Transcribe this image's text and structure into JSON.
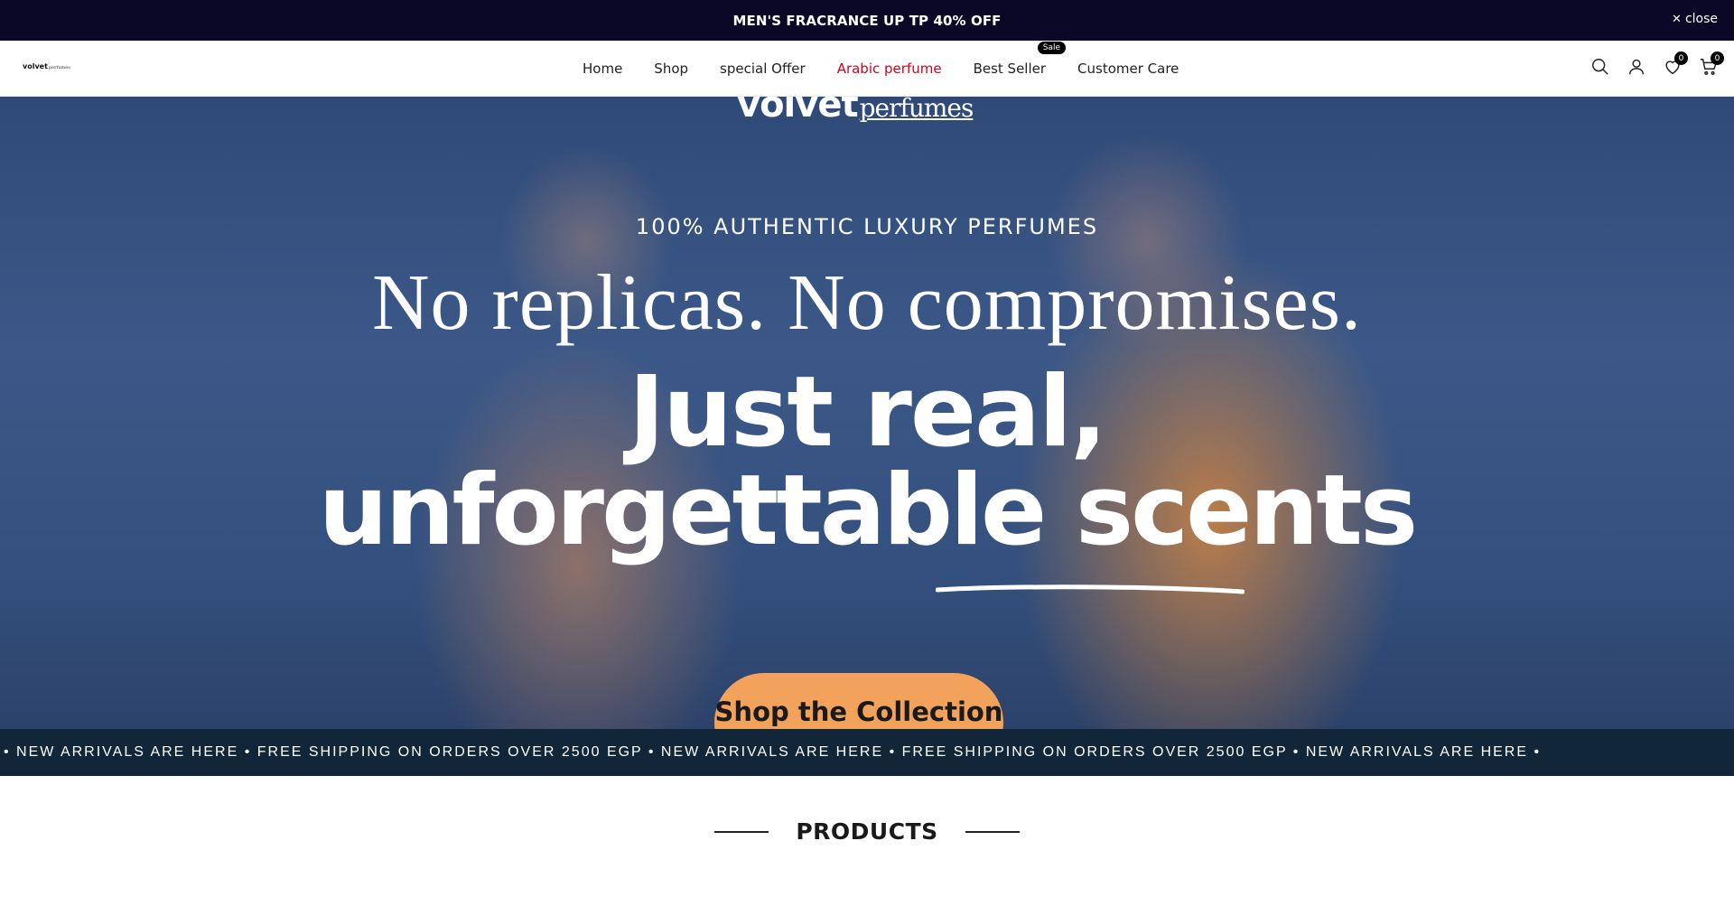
{
  "announcement": {
    "text": "MEN'S FRACRANCE UP TP 40% OFF",
    "close_label": "close",
    "close_icon": "close-icon"
  },
  "header": {
    "logo": {
      "main": "volvet",
      "sub": "perfumes"
    },
    "nav": [
      {
        "label": "Home"
      },
      {
        "label": "Shop"
      },
      {
        "label": "special Offer"
      },
      {
        "label": "Arabic perfume",
        "color": "#d0021b"
      },
      {
        "label": "Best Seller",
        "badge": "Sale"
      },
      {
        "label": "Customer Care"
      }
    ],
    "icons": {
      "search": "search-icon",
      "account": "user-icon",
      "wishlist": {
        "icon": "heart-icon",
        "count": "0"
      },
      "cart": {
        "icon": "cart-icon",
        "count": "0"
      }
    }
  },
  "hero": {
    "logo": {
      "main": "volvet",
      "sub": "perfumes"
    },
    "kicker": "100% AUTHENTIC LUXURY PERFUMES",
    "line1": "No replicas. No compromises.",
    "line2": "Just real,",
    "line3": "unforgettable scents",
    "cta": "Shop the Collection",
    "cta_color": "#f2a25a"
  },
  "marquee": {
    "text": "• NEW ARRIVALS ARE HERE • FREE SHIPPING ON ORDERS OVER 2500 EGP • NEW ARRIVALS ARE HERE • FREE SHIPPING ON ORDERS OVER 2500 EGP • NEW ARRIVALS ARE HERE •"
  },
  "products": {
    "title": "PRODUCTS"
  },
  "colors": {
    "announcement_bg": "#0b0726",
    "marquee_bg": "#112638",
    "accent_red": "#d0021b"
  }
}
